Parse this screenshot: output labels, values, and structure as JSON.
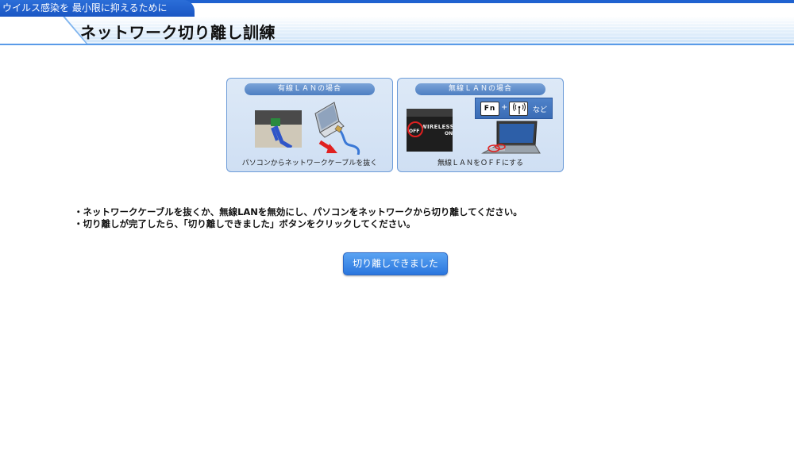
{
  "header": {
    "tab_label": "ウイルス感染を 最小限に抑えるために",
    "page_title": "ネットワーク切り離し訓練"
  },
  "panels": [
    {
      "header": "有線ＬＡＮの場合",
      "caption": "パソコンからネットワークケーブルを抜く"
    },
    {
      "header": "無線ＬＡＮの場合",
      "caption": "無線ＬＡＮをＯＦＦにする",
      "key_label": "Fn",
      "plus": "+",
      "etc": "など",
      "switch_label": "WIRELESS",
      "switch_on": "ON",
      "switch_off": "OFF"
    }
  ],
  "instructions": [
    "・ネットワークケーブルを抜くか、無線LANを無効にし、パソコンをネットワークから切り離してください。",
    "・切り離しが完了したら、「切り離しできました」ボタンをクリックしてください。"
  ],
  "confirm_button": "切り離しできました",
  "colors": {
    "accent": "#1f62d0",
    "button": "#2a76de",
    "arrow": "#e02020"
  }
}
